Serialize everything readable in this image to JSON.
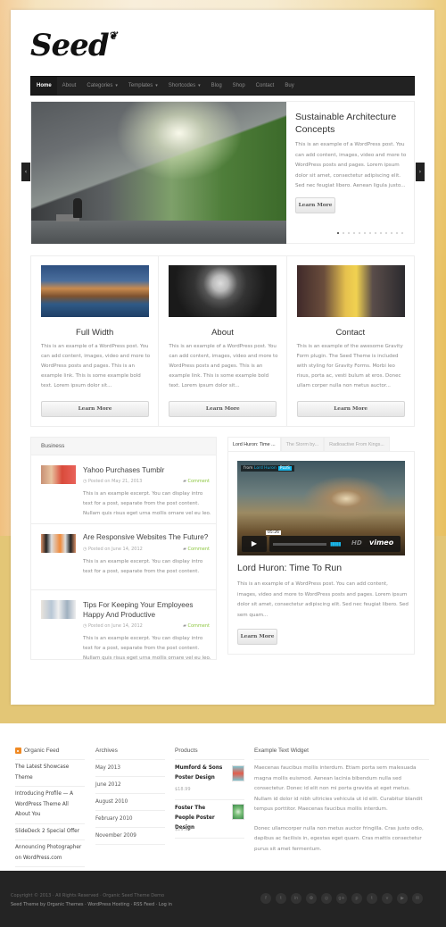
{
  "site": {
    "logo": "Seed"
  },
  "nav": [
    {
      "label": "Home",
      "active": true
    },
    {
      "label": "About"
    },
    {
      "label": "Categories",
      "dropdown": true
    },
    {
      "label": "Templates",
      "dropdown": true
    },
    {
      "label": "Shortcodes",
      "dropdown": true
    },
    {
      "label": "Blog"
    },
    {
      "label": "Shop"
    },
    {
      "label": "Contact"
    },
    {
      "label": "Buy"
    }
  ],
  "slider": {
    "title": "Sustainable Architecture Concepts",
    "body": "This is an example of a WordPress post. You can add content, images, video and more to WordPress posts and pages. Lorem ipsum dolor sit amet, consectetur adipiscing elit. Sed nec feugiat libero. Aenean ligula justo...",
    "button": "Learn More",
    "slide_count": 13,
    "active_slide": 1,
    "prev": "‹",
    "next": "›"
  },
  "features": [
    {
      "title": "Full Width",
      "body": "This is an example of a WordPress post. You can add content, images, video and more to WordPress posts and pages. This is an example link. This is some example bold text. Lorem ipsum dolor sit...",
      "button": "Learn More"
    },
    {
      "title": "About",
      "body": "This is an example of a WordPress post. You can add content, images, video and more to WordPress posts and pages. This is an example link. This is some example bold text. Lorem ipsum dolor sit...",
      "button": "Learn More"
    },
    {
      "title": "Contact",
      "body": "This is an example of the awesome Gravity Form plugin. The Seed Theme is included with styling for Gravity Forms. Morbi leo risus, porta ac, vesti bulum at eros. Donec ullam corper nulla non metus auctor...",
      "button": "Learn More"
    }
  ],
  "business": {
    "heading": "Business",
    "posts": [
      {
        "title": "Yahoo Purchases Tumblr",
        "date": "Posted on May 21, 2013",
        "comment": "Comment",
        "excerpt": "This is an example excerpt. You can display intro text for a post, separate from the post content. Nullam quis risus eget urna mollis ornare vel eu leo."
      },
      {
        "title": "Are Responsive Websites The Future?",
        "date": "Posted on June 14, 2012",
        "comment": "Comment",
        "excerpt": "This is an example excerpt. You can display intro text for a post, separate from the post content."
      },
      {
        "title": "Tips For Keeping Your Employees Happy And Productive",
        "date": "Posted on June 14, 2012",
        "comment": "Comment",
        "excerpt": "This is an example excerpt. You can display intro text for a post, separate from the post content. Nullam quis risus eget urna mollis ornare vel eu leo."
      }
    ]
  },
  "video": {
    "tabs": [
      "Lord Huron: Time ...",
      "The Storm by...",
      "Radioactive From Kings..."
    ],
    "from_label": "from",
    "from_user": "Lord Huron",
    "badge": "PLUS",
    "time": "05:26",
    "hd": "HD",
    "brand": "vimeo",
    "title": "Lord Huron: Time To Run",
    "body": "This is an example of a WordPress post. You can add content, images, video and more to WordPress posts and pages. Lorem ipsum dolor sit amet, consectetur adipiscing elit. Sed nec feugiat libero. Sed sem quam...",
    "button": "Learn More"
  },
  "footer_widgets": {
    "feed": {
      "heading": "Organic Feed",
      "items": [
        "The Latest Showcase Theme",
        "Introducing Profile — A WordPress Theme All About You",
        "SlideDeck 2 Special Offer",
        "Announcing Photographer on WordPress.com"
      ]
    },
    "archives": {
      "heading": "Archives",
      "items": [
        "May 2013",
        "June 2012",
        "August 2010",
        "February 2010",
        "November 2009"
      ]
    },
    "products": {
      "heading": "Products",
      "items": [
        {
          "name": "Mumford & Sons Poster Design",
          "price": "$18.99"
        },
        {
          "name": "Foster The People Poster Design",
          "price": "$29.99"
        }
      ]
    },
    "text": {
      "heading": "Example Text Widget",
      "p1": "Maecenas faucibus mollis interdum. Etiam porta sem malesuada magna mollis euismod. Aenean lacinia bibendum nulla sed consectetur. Donec id elit non mi porta gravida at eget metus. Nullam id dolor id nibh ultricies vehicula ut id elit. Curabitur blandit tempus porttitor. Maecenas faucibus mollis interdum.",
      "p2": "Donec ullamcorper nulla non metus auctor fringilla. Cras justo odio, dapibus ac facilisis in, egestas eget quam. Cras mattis consectetur purus sit amet fermentum."
    }
  },
  "footer": {
    "line1": "Copyright © 2013 · All Rights Reserved · Organic Seed Theme Demo",
    "line2": "Seed Theme by Organic Themes · WordPress Hosting · RSS Feed · Log in",
    "social": [
      "facebook-icon",
      "twitter-icon",
      "linkedin-icon",
      "flickr-icon",
      "instagram-icon",
      "google-plus-icon",
      "pinterest-icon",
      "tumblr-icon",
      "vimeo-icon",
      "youtube-icon",
      "email-icon"
    ],
    "social_glyphs": [
      "f",
      "t",
      "in",
      "✿",
      "◎",
      "g+",
      "p",
      "t",
      "v",
      "▶",
      "✉"
    ]
  },
  "colors": {
    "accent_green": "#8cc63f",
    "nav_bg": "#222222",
    "vimeo_blue": "#1ab7ea",
    "background_gold": "#e3c676"
  }
}
